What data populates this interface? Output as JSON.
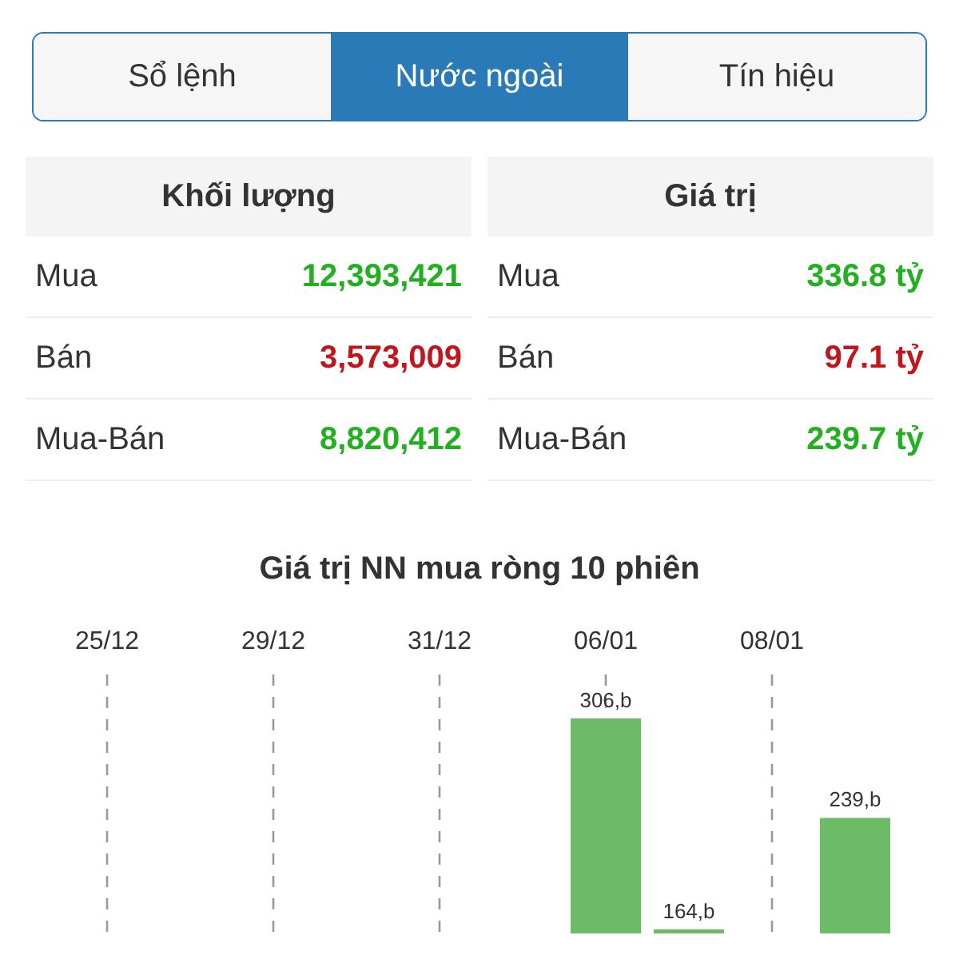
{
  "tabs": [
    {
      "label": "Sổ lệnh",
      "selected": false
    },
    {
      "label": "Nước ngoài",
      "selected": true
    },
    {
      "label": "Tín hiệu",
      "selected": false
    }
  ],
  "tables": [
    {
      "title": "Khối lượng",
      "rows": [
        {
          "label": "Mua",
          "value": "12,393,421",
          "color": "#22b020"
        },
        {
          "label": "Bán",
          "value": "3,573,009",
          "color": "#c0161d"
        },
        {
          "label": "Mua-Bán",
          "value": "8,820,412",
          "color": "#22b020"
        }
      ]
    },
    {
      "title": "Giá trị",
      "rows": [
        {
          "label": "Mua",
          "value": "336.8 tỷ",
          "color": "#22b020"
        },
        {
          "label": "Bán",
          "value": "97.1 tỷ",
          "color": "#c0161d"
        },
        {
          "label": "Mua-Bán",
          "value": "239.7 tỷ",
          "color": "#22b020"
        }
      ]
    }
  ],
  "chart": {
    "chart_data": {
      "type": "bar",
      "title": "Giá trị NN mua ròng 10 phiên",
      "categories": [
        "25/12",
        null,
        "29/12",
        null,
        "31/12",
        null,
        "06/01",
        null,
        "08/01",
        null
      ],
      "values": [
        null,
        null,
        null,
        null,
        null,
        null,
        306,
        164,
        null,
        239
      ],
      "value_labels": [
        null,
        null,
        null,
        null,
        null,
        null,
        "306,b",
        "164,b",
        null,
        "239,b"
      ]
    }
  }
}
